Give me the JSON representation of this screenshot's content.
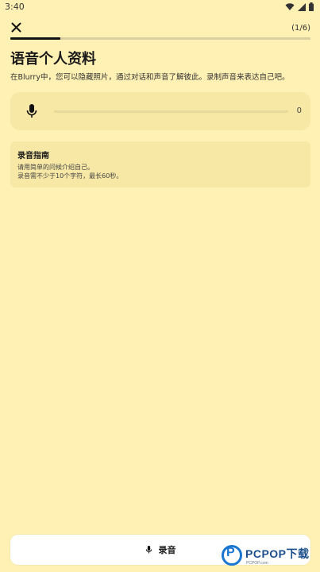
{
  "status_bar": {
    "time": "3:40",
    "icons": [
      "wifi-icon",
      "signal-icon",
      "battery-icon"
    ]
  },
  "header": {
    "close_icon": "close-icon",
    "step_counter": "(1/6)",
    "progress": 0.167
  },
  "page": {
    "title": "语音个人资料",
    "description": "在Blurry中，您可以隐藏照片，通过对话和声音了解彼此。录制声音来表达自己吧。"
  },
  "recorder": {
    "icon": "mic-icon",
    "duration": "0"
  },
  "guide": {
    "title": "录音指南",
    "lines": [
      "请用简单的问候介绍自己。",
      "录音需不少于10个字符，最长60秒。"
    ]
  },
  "record_button": {
    "icon": "mic-icon",
    "label": "录音"
  },
  "watermark": {
    "brand": "PCPOP下载",
    "sub": "PCPOP.com"
  },
  "colors": {
    "background": "#FFF1B4",
    "card": "#F7E8A6",
    "progress_fill": "#111111",
    "progress_track": "#D9CFA0",
    "watermark_blue": "#1976D2"
  }
}
